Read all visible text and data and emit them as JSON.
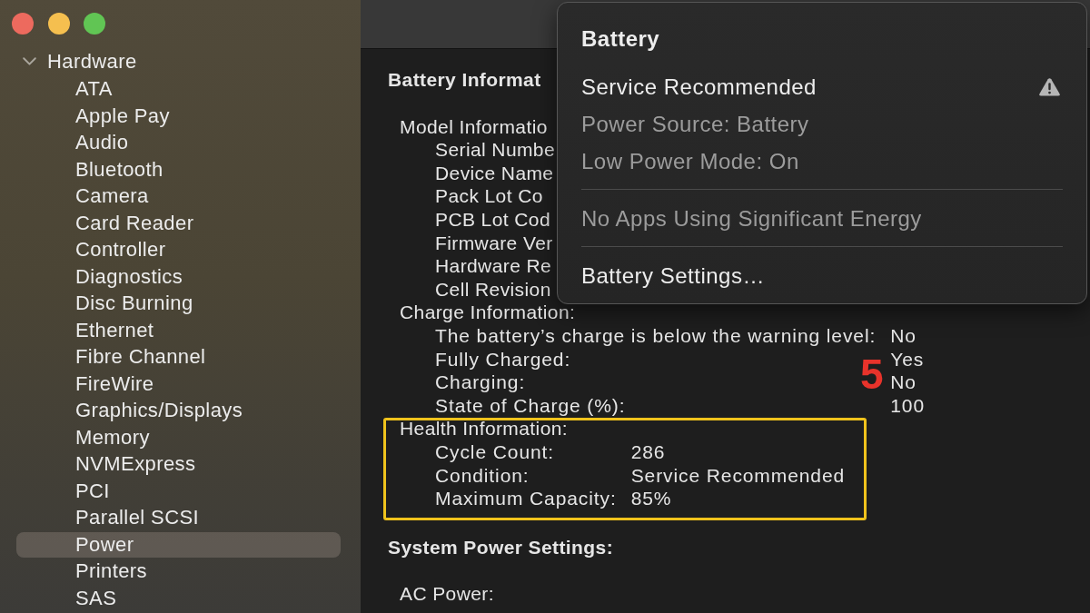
{
  "sidebar": {
    "tree": [
      {
        "label": "Hardware",
        "expanded": true,
        "children": [
          {
            "label": "ATA",
            "selected": false
          },
          {
            "label": "Apple Pay",
            "selected": false
          },
          {
            "label": "Audio",
            "selected": false
          },
          {
            "label": "Bluetooth",
            "selected": false
          },
          {
            "label": "Camera",
            "selected": false
          },
          {
            "label": "Card Reader",
            "selected": false
          },
          {
            "label": "Controller",
            "selected": false
          },
          {
            "label": "Diagnostics",
            "selected": false
          },
          {
            "label": "Disc Burning",
            "selected": false
          },
          {
            "label": "Ethernet",
            "selected": false
          },
          {
            "label": "Fibre Channel",
            "selected": false
          },
          {
            "label": "FireWire",
            "selected": false
          },
          {
            "label": "Graphics/Displays",
            "selected": false
          },
          {
            "label": "Memory",
            "selected": false
          },
          {
            "label": "NVMExpress",
            "selected": false
          },
          {
            "label": "PCI",
            "selected": false
          },
          {
            "label": "Parallel SCSI",
            "selected": false
          },
          {
            "label": "Power",
            "selected": true
          },
          {
            "label": "Printers",
            "selected": false
          },
          {
            "label": "SAS",
            "selected": false
          }
        ]
      }
    ]
  },
  "detail": {
    "sections": [
      {
        "title": "Battery Informat",
        "groups": [
          {
            "label": "Model Informatio",
            "highlighted": false,
            "rows": [
              {
                "label": "Serial Numbe"
              },
              {
                "label": "Device Name"
              },
              {
                "label": "Pack Lot Co"
              },
              {
                "label": "PCB Lot Cod"
              },
              {
                "label": "Firmware Ver"
              },
              {
                "label": "Hardware Re"
              },
              {
                "label": "Cell Revision"
              }
            ]
          },
          {
            "label": "Charge Information:",
            "highlighted": false,
            "rows": [
              {
                "label": "The battery’s charge is below the warning level:",
                "value": "No"
              },
              {
                "label": "Fully Charged:",
                "value": "Yes"
              },
              {
                "label": "Charging:",
                "value": "No"
              },
              {
                "label": "State of Charge (%):",
                "value": "100"
              }
            ]
          },
          {
            "label": "Health Information:",
            "highlighted": true,
            "rows": [
              {
                "label": "Cycle Count:",
                "value": "286"
              },
              {
                "label": "Condition:",
                "value": "Service Recommended"
              },
              {
                "label": "Maximum Capacity:",
                "value": "85%"
              }
            ]
          }
        ]
      },
      {
        "title": "System Power Settings:",
        "groups": [
          {
            "label": "AC Power:",
            "highlighted": false
          }
        ]
      }
    ]
  },
  "battery_menu": {
    "title": "Battery",
    "sections": [
      {
        "items": [
          {
            "label": "Service Recommended",
            "disabled": false,
            "alert": true
          },
          {
            "label": "Power Source: Battery",
            "disabled": true,
            "alert": false
          },
          {
            "label": "Low Power Mode: On",
            "disabled": true,
            "alert": false
          }
        ]
      },
      {
        "items": [
          {
            "label": "No Apps Using Significant Energy",
            "disabled": true,
            "alert": false
          }
        ]
      },
      {
        "items": [
          {
            "label": "Battery Settings…",
            "disabled": false,
            "alert": false
          }
        ]
      }
    ]
  },
  "annotation": {
    "step": "5"
  }
}
